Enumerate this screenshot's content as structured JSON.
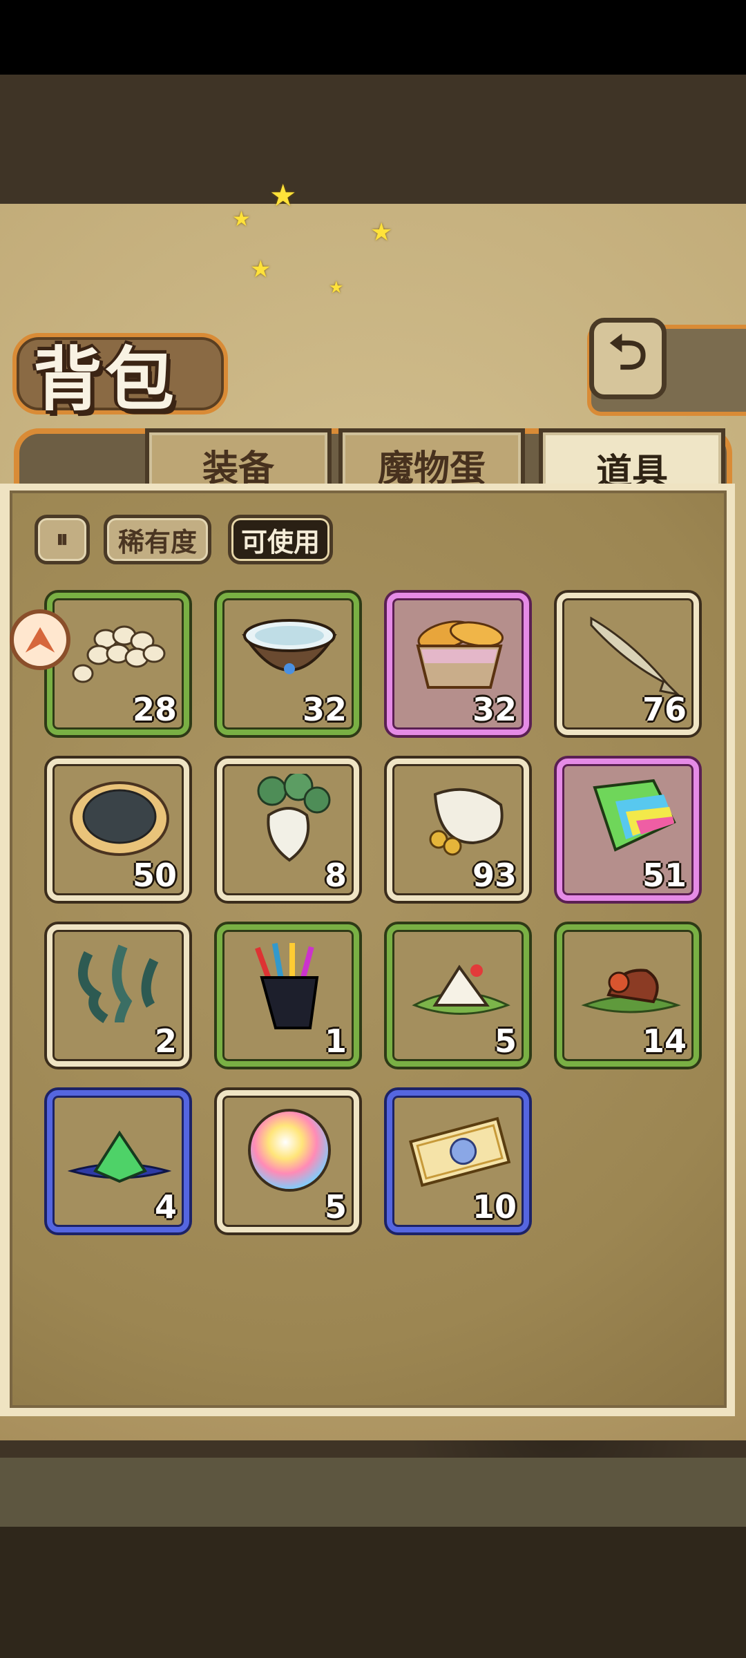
{
  "header": {
    "title": "背包"
  },
  "tabs": [
    {
      "label": "装备"
    },
    {
      "label": "魔物蛋"
    },
    {
      "label": "道具"
    }
  ],
  "filters": {
    "rarity": "稀有度",
    "usable": "可使用"
  },
  "items": [
    {
      "name": "bean-pile-icon",
      "count": "28"
    },
    {
      "name": "water-bowl-icon",
      "count": "32"
    },
    {
      "name": "bread-basket-icon",
      "count": "32"
    },
    {
      "name": "fish-icon",
      "count": "76"
    },
    {
      "name": "pie-icon",
      "count": "50"
    },
    {
      "name": "turnip-icon",
      "count": "8"
    },
    {
      "name": "coin-sack-icon",
      "count": "93"
    },
    {
      "name": "rainbow-cake-icon",
      "count": "51"
    },
    {
      "name": "seaweed-icon",
      "count": "2"
    },
    {
      "name": "pen-cup-icon",
      "count": "1"
    },
    {
      "name": "rice-ball-icon",
      "count": "5"
    },
    {
      "name": "meat-leaf-icon",
      "count": "14"
    },
    {
      "name": "green-crystal-icon",
      "count": "4"
    },
    {
      "name": "rainbow-orb-icon",
      "count": "5"
    },
    {
      "name": "ticket-icon",
      "count": "10"
    }
  ]
}
